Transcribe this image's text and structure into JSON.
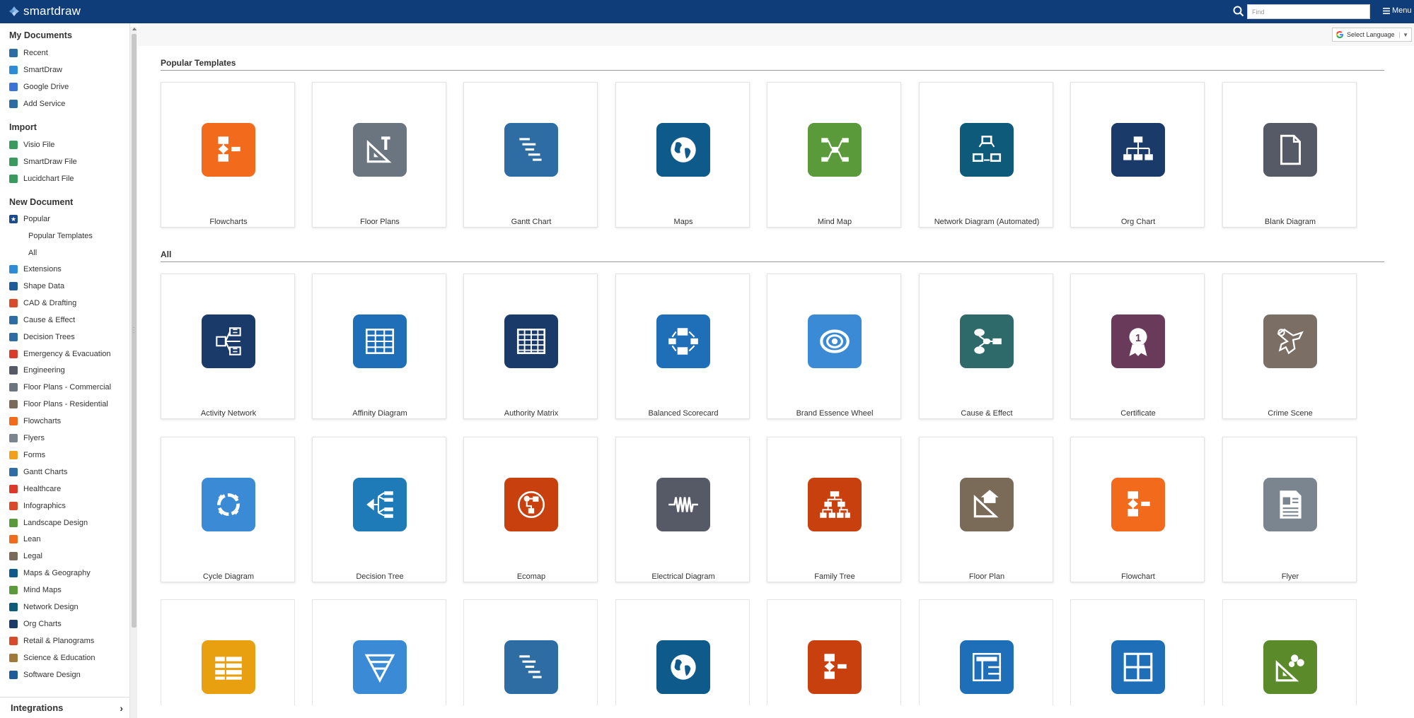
{
  "app": {
    "name": "smartdraw"
  },
  "header": {
    "find_placeholder": "Find",
    "menu_label": "Menu"
  },
  "language": {
    "label": "Select Language"
  },
  "sidebar": {
    "my_documents": {
      "title": "My Documents",
      "items": [
        {
          "label": "Recent",
          "icon": "clock-icon",
          "color": "#2e6da4"
        },
        {
          "label": "SmartDraw",
          "icon": "smartdraw-icon",
          "color": "#2e8bd6"
        },
        {
          "label": "Google Drive",
          "icon": "google-drive-icon",
          "color": "#3b73d6"
        },
        {
          "label": "Add Service",
          "icon": "add-icon",
          "color": "#2e6da4"
        }
      ]
    },
    "import": {
      "title": "Import",
      "items": [
        {
          "label": "Visio File",
          "icon": "cloud-upload-icon",
          "color": "#3a9a5b"
        },
        {
          "label": "SmartDraw File",
          "icon": "cloud-upload-icon",
          "color": "#3a9a5b"
        },
        {
          "label": "Lucidchart File",
          "icon": "cloud-upload-icon",
          "color": "#3a9a5b"
        }
      ]
    },
    "new_document": {
      "title": "New Document",
      "popular": {
        "label": "Popular",
        "icon": "star-icon",
        "color": "#1a4a8a"
      },
      "sub_items": [
        "Popular Templates",
        "All"
      ],
      "items": [
        {
          "label": "Extensions",
          "icon": "gear-icon",
          "color": "#2e8bd6"
        },
        {
          "label": "Shape Data",
          "icon": "info-icon",
          "color": "#1f5a9a"
        },
        {
          "label": "CAD & Drafting",
          "icon": "cad-icon",
          "color": "#d94a2a"
        },
        {
          "label": "Cause & Effect",
          "icon": "cause-effect-icon",
          "color": "#2e6da4"
        },
        {
          "label": "Decision Trees",
          "icon": "decision-tree-icon",
          "color": "#2e6da4"
        },
        {
          "label": "Emergency & Evacuation",
          "icon": "emergency-icon",
          "color": "#d93a2a"
        },
        {
          "label": "Engineering",
          "icon": "engineering-icon",
          "color": "#555a66"
        },
        {
          "label": "Floor Plans - Commercial",
          "icon": "floor-plan-icon",
          "color": "#6b7580"
        },
        {
          "label": "Floor Plans - Residential",
          "icon": "floor-plan-icon",
          "color": "#7a6a58"
        },
        {
          "label": "Flowcharts",
          "icon": "flowchart-icon",
          "color": "#f26b1d"
        },
        {
          "label": "Flyers",
          "icon": "flyer-icon",
          "color": "#7a8590"
        },
        {
          "label": "Forms",
          "icon": "form-icon",
          "color": "#f0a020"
        },
        {
          "label": "Gantt Charts",
          "icon": "gantt-icon",
          "color": "#2e6da4"
        },
        {
          "label": "Healthcare",
          "icon": "healthcare-icon",
          "color": "#d93a2a"
        },
        {
          "label": "Infographics",
          "icon": "infographic-icon",
          "color": "#d94a2a"
        },
        {
          "label": "Landscape Design",
          "icon": "landscape-icon",
          "color": "#5a9a3a"
        },
        {
          "label": "Lean",
          "icon": "lean-icon",
          "color": "#f26b1d"
        },
        {
          "label": "Legal",
          "icon": "legal-icon",
          "color": "#7a6a58"
        },
        {
          "label": "Maps & Geography",
          "icon": "globe-icon",
          "color": "#0e5a8a"
        },
        {
          "label": "Mind Maps",
          "icon": "mind-map-icon",
          "color": "#5a9a3a"
        },
        {
          "label": "Network Design",
          "icon": "network-icon",
          "color": "#0e5a7a"
        },
        {
          "label": "Org Charts",
          "icon": "org-chart-icon",
          "color": "#1a3a6a"
        },
        {
          "label": "Retail & Planograms",
          "icon": "retail-icon",
          "color": "#d94a2a"
        },
        {
          "label": "Science & Education",
          "icon": "science-icon",
          "color": "#a07a3a"
        },
        {
          "label": "Software Design",
          "icon": "software-icon",
          "color": "#1f5a9a"
        }
      ]
    },
    "integrations_label": "Integrations"
  },
  "popular_templates": {
    "title": "Popular Templates",
    "tiles": [
      {
        "label": "Flowcharts",
        "icon": "flowchart-icon",
        "color": "#f26b1d"
      },
      {
        "label": "Floor Plans",
        "icon": "floor-plan-icon",
        "color": "#6b7580"
      },
      {
        "label": "Gantt Chart",
        "icon": "gantt-icon",
        "color": "#2e6da4"
      },
      {
        "label": "Maps",
        "icon": "globe-icon",
        "color": "#0e5a8a"
      },
      {
        "label": "Mind Map",
        "icon": "mind-map-icon",
        "color": "#5a9a3a"
      },
      {
        "label": "Network Diagram (Automated)",
        "icon": "network-icon",
        "color": "#0e5a7a"
      },
      {
        "label": "Org Chart",
        "icon": "org-chart-icon",
        "color": "#1a3a6a"
      },
      {
        "label": "Blank Diagram",
        "icon": "blank-document-icon",
        "color": "#555a66"
      }
    ]
  },
  "all_templates": {
    "title": "All",
    "tiles": [
      {
        "label": "Activity Network",
        "icon": "activity-network-icon",
        "color": "#1a3a6a"
      },
      {
        "label": "Affinity Diagram",
        "icon": "table-icon",
        "color": "#1f6fb8"
      },
      {
        "label": "Authority Matrix",
        "icon": "grid-icon",
        "color": "#1a3a6a"
      },
      {
        "label": "Balanced Scorecard",
        "icon": "cycle-boxes-icon",
        "color": "#1f6fb8"
      },
      {
        "label": "Brand Essence Wheel",
        "icon": "target-icon",
        "color": "#3a8ad6"
      },
      {
        "label": "Cause & Effect",
        "icon": "cause-effect-icon",
        "color": "#2e6a6a"
      },
      {
        "label": "Certificate",
        "icon": "award-icon",
        "color": "#6a3a5a"
      },
      {
        "label": "Crime Scene",
        "icon": "body-outline-icon",
        "color": "#7a6e65"
      },
      {
        "label": "Cycle Diagram",
        "icon": "cycle-icon",
        "color": "#3a8ad6"
      },
      {
        "label": "Decision Tree",
        "icon": "decision-tree-icon",
        "color": "#1f7ab8"
      },
      {
        "label": "Ecomap",
        "icon": "ecomap-icon",
        "color": "#c8400e"
      },
      {
        "label": "Electrical Diagram",
        "icon": "resistor-icon",
        "color": "#555a66"
      },
      {
        "label": "Family Tree",
        "icon": "family-tree-icon",
        "color": "#c8400e"
      },
      {
        "label": "Floor Plan",
        "icon": "floor-plan-home-icon",
        "color": "#7a6a58"
      },
      {
        "label": "Flowchart",
        "icon": "flowchart-icon",
        "color": "#f26b1d"
      },
      {
        "label": "Flyer",
        "icon": "flyer-icon",
        "color": "#7a8590"
      },
      {
        "label": "",
        "icon": "form-icon",
        "color": "#e8a010"
      },
      {
        "label": "",
        "icon": "funnel-icon",
        "color": "#3a8ad6"
      },
      {
        "label": "",
        "icon": "gantt-icon",
        "color": "#2e6da4"
      },
      {
        "label": "",
        "icon": "globe-icon",
        "color": "#0e5a8a"
      },
      {
        "label": "",
        "icon": "flowchart-icon",
        "color": "#c8400e"
      },
      {
        "label": "",
        "icon": "infographic-icon",
        "color": "#1f6fb8"
      },
      {
        "label": "",
        "icon": "window-icon",
        "color": "#1f6fb8"
      },
      {
        "label": "",
        "icon": "landscape-icon",
        "color": "#5a8a2a"
      }
    ]
  }
}
